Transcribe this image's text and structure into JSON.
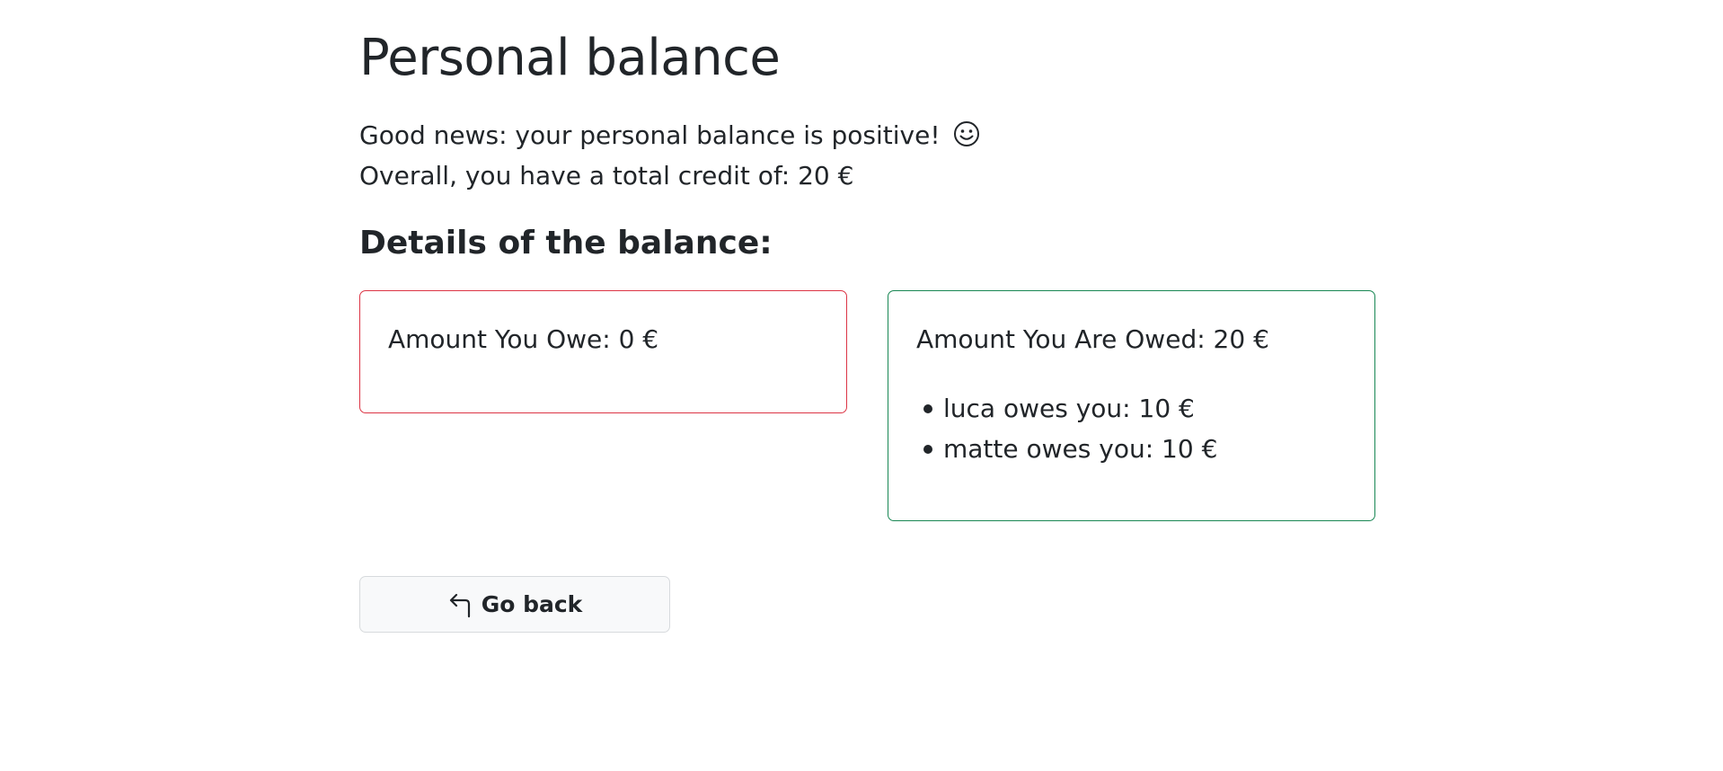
{
  "page": {
    "title": "Personal balance"
  },
  "intro": {
    "message": "Good news: your personal balance is positive!",
    "icon": "smile-icon",
    "credit_line": "Overall, you have a total credit of: 20 €"
  },
  "details": {
    "title": "Details of the balance:",
    "owe": {
      "title": "Amount You Owe: 0 €",
      "border_color": "#dc3545",
      "items": []
    },
    "owed": {
      "title": "Amount You Are Owed: 20 €",
      "border_color": "#198754",
      "items": [
        "luca owes you: 10 €",
        "matte owes you: 10 €"
      ]
    }
  },
  "actions": {
    "back_label": "Go back",
    "back_icon": "arrow-return-left-icon"
  }
}
